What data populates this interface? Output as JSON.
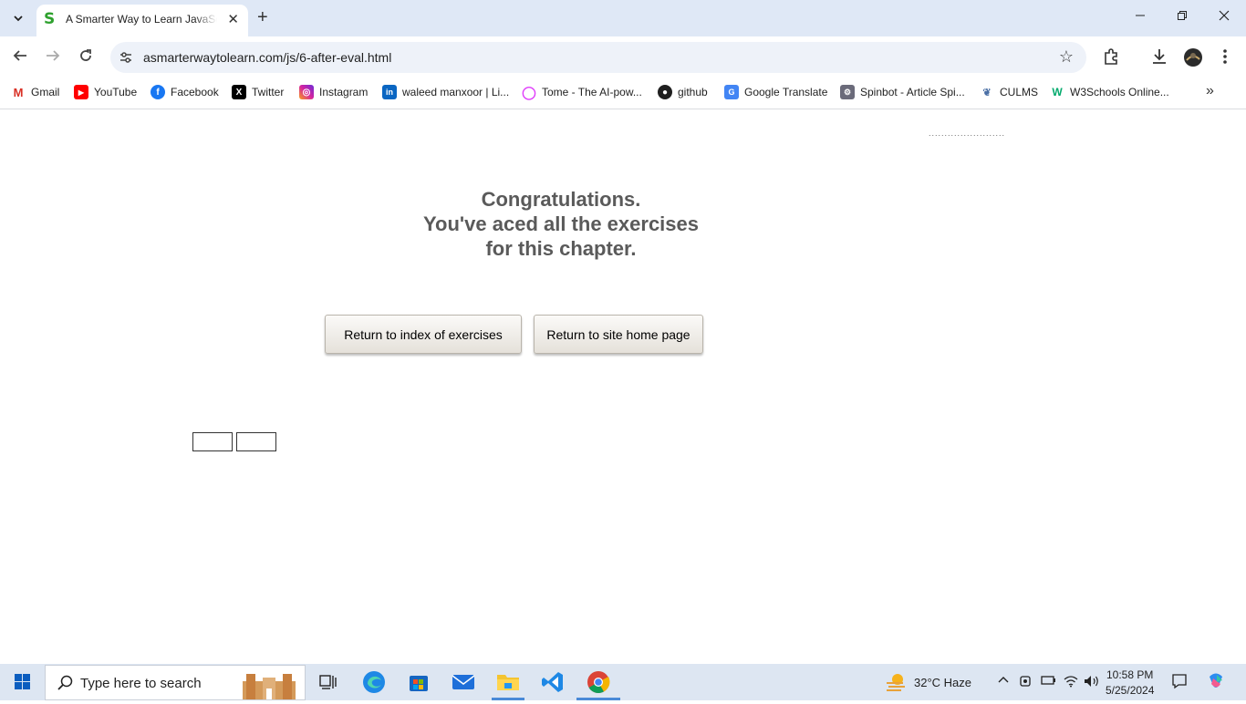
{
  "browser": {
    "tab_title": "A Smarter Way to Learn JavaScript",
    "url": "asmarterwaytolearn.com/js/6-after-eval.html",
    "bookmarks": [
      {
        "label": "Gmail",
        "icon": "gmail-icon"
      },
      {
        "label": "YouTube",
        "icon": "youtube-icon"
      },
      {
        "label": "Facebook",
        "icon": "facebook-icon"
      },
      {
        "label": "Twitter",
        "icon": "x-twitter-icon"
      },
      {
        "label": "Instagram",
        "icon": "instagram-icon"
      },
      {
        "label": "waleed manxoor | Li...",
        "icon": "linkedin-icon"
      },
      {
        "label": "Tome - The AI-pow...",
        "icon": "tome-icon"
      },
      {
        "label": "github",
        "icon": "github-icon"
      },
      {
        "label": "Google Translate",
        "icon": "google-translate-icon"
      },
      {
        "label": "Spinbot - Article Spi...",
        "icon": "spinbot-icon"
      },
      {
        "label": "CULMS",
        "icon": "culms-icon"
      },
      {
        "label": "W3Schools Online...",
        "icon": "w3schools-icon"
      }
    ]
  },
  "page": {
    "congrats_line1": "Congratulations.",
    "congrats_line2": "You've aced all the exercises",
    "congrats_line3": "for this chapter.",
    "btn_index": "Return to index of exercises",
    "btn_home": "Return to site home page",
    "dots": "........................"
  },
  "taskbar": {
    "search_placeholder": "Type here to search",
    "weather": "32°C  Haze",
    "time": "10:58 PM",
    "date": "5/25/2024"
  },
  "colors": {
    "congrats_text": "#5a5a5a",
    "tabbar_bg": "#dfe8f6",
    "taskbar_bg": "#dde6f2"
  }
}
